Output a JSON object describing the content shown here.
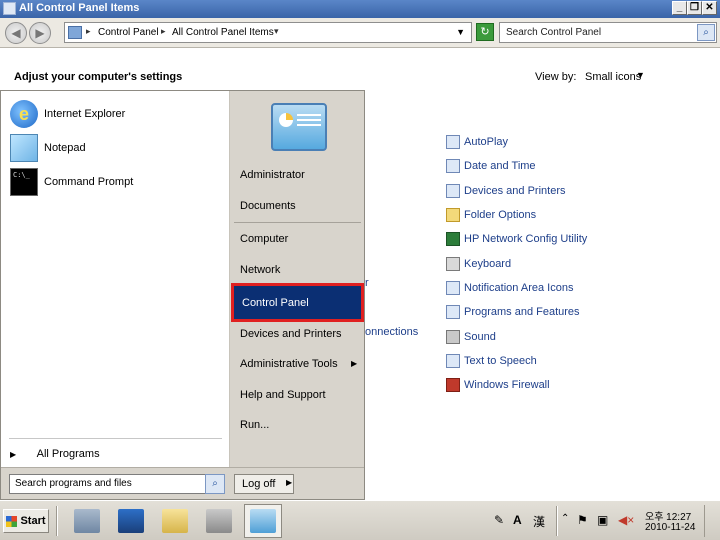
{
  "window": {
    "title": "All Control Panel Items"
  },
  "address": {
    "crumbs": [
      "Control Panel",
      "All Control Panel Items"
    ],
    "search_placeholder": "Search Control Panel"
  },
  "content": {
    "heading": "Adjust your computer's settings",
    "view_by_label": "View by:",
    "view_by_value": "Small icons",
    "items": [
      {
        "label": "AutoPlay",
        "icon": "autoplay-icon"
      },
      {
        "label": "Date and Time",
        "icon": "clock-icon"
      },
      {
        "label": "Devices and Printers",
        "icon": "printer-icon"
      },
      {
        "label": "Folder Options",
        "icon": "folder-icon"
      },
      {
        "label": "HP Network Config Utility",
        "icon": "network-utility-icon"
      },
      {
        "label": "Keyboard",
        "icon": "keyboard-icon"
      },
      {
        "label": "Notification Area Icons",
        "icon": "notification-icon"
      },
      {
        "label": "Programs and Features",
        "icon": "programs-icon"
      },
      {
        "label": "Sound",
        "icon": "speaker-icon"
      },
      {
        "label": "Text to Speech",
        "icon": "speech-icon"
      },
      {
        "label": "Windows Firewall",
        "icon": "firewall-icon"
      }
    ],
    "hidden_fragments": [
      "r",
      "onnections"
    ]
  },
  "start_menu": {
    "pinned": [
      {
        "label": "Internet Explorer",
        "icon": "internet-explorer-icon"
      },
      {
        "label": "Notepad",
        "icon": "notepad-icon"
      },
      {
        "label": "Command Prompt",
        "icon": "command-prompt-icon"
      }
    ],
    "all_programs": "All Programs",
    "right_items": {
      "administrator": "Administrator",
      "documents": "Documents",
      "computer": "Computer",
      "network": "Network",
      "control_panel": "Control Panel",
      "devices": "Devices and Printers",
      "admin_tools": "Administrative Tools",
      "help": "Help and Support",
      "run": "Run..."
    },
    "search_placeholder": "Search programs and files",
    "logoff_label": "Log off"
  },
  "taskbar": {
    "start_label": "Start",
    "ime_letter": "A",
    "ime_hanja": "漢",
    "clock_time": "오후 12:27",
    "clock_date": "2010-11-24"
  }
}
